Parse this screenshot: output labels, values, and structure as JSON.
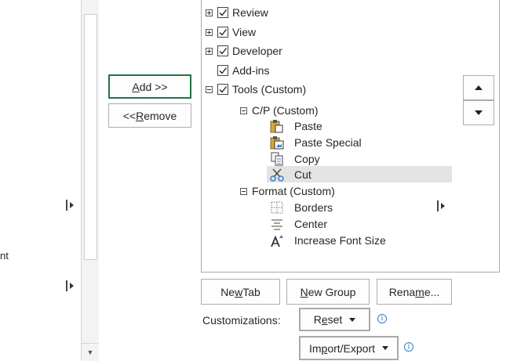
{
  "left_panel": {
    "partial_label": "nt"
  },
  "buttons": {
    "add": {
      "prefix": "",
      "ul": "A",
      "rest": "dd >>"
    },
    "remove": {
      "prefix": "<< ",
      "ul": "R",
      "rest": "emove"
    },
    "new_tab": {
      "prefix": "Ne",
      "ul": "w",
      "rest": " Tab"
    },
    "new_group": {
      "prefix": "",
      "ul": "N",
      "rest": "ew Group"
    },
    "rename": {
      "prefix": "Rena",
      "ul": "m",
      "rest": "e..."
    },
    "reset": {
      "prefix": "R",
      "ul": "e",
      "rest": "set"
    },
    "import_export": {
      "prefix": "Im",
      "ul": "p",
      "rest": "ort/Export"
    }
  },
  "customizations_label": "Customizations:",
  "tree": {
    "tabs": [
      {
        "label": "Review",
        "checked": true,
        "expander": "plus"
      },
      {
        "label": "View",
        "checked": true,
        "expander": "plus"
      },
      {
        "label": "Developer",
        "checked": true,
        "expander": "plus"
      },
      {
        "label": "Add-ins",
        "checked": true,
        "expander": "none"
      },
      {
        "label": "Tools (Custom)",
        "checked": true,
        "expander": "minus"
      }
    ],
    "group_cp": {
      "label": "C/P (Custom)",
      "commands": [
        {
          "label": "Paste",
          "icon": "paste-icon"
        },
        {
          "label": "Paste Special",
          "icon": "paste-special-icon"
        },
        {
          "label": "Copy",
          "icon": "copy-icon"
        },
        {
          "label": "Cut",
          "icon": "scissors-icon",
          "selected": true
        }
      ]
    },
    "group_format": {
      "label": "Format (Custom)",
      "commands": [
        {
          "label": "Borders",
          "icon": "borders-icon"
        },
        {
          "label": "Center",
          "icon": "center-align-icon"
        },
        {
          "label": "Increase Font Size",
          "icon": "increase-font-size-icon"
        }
      ]
    }
  },
  "colors": {
    "focus_border": "#217346",
    "selection": "#e3e3e3",
    "info": "#3b7ec9"
  }
}
